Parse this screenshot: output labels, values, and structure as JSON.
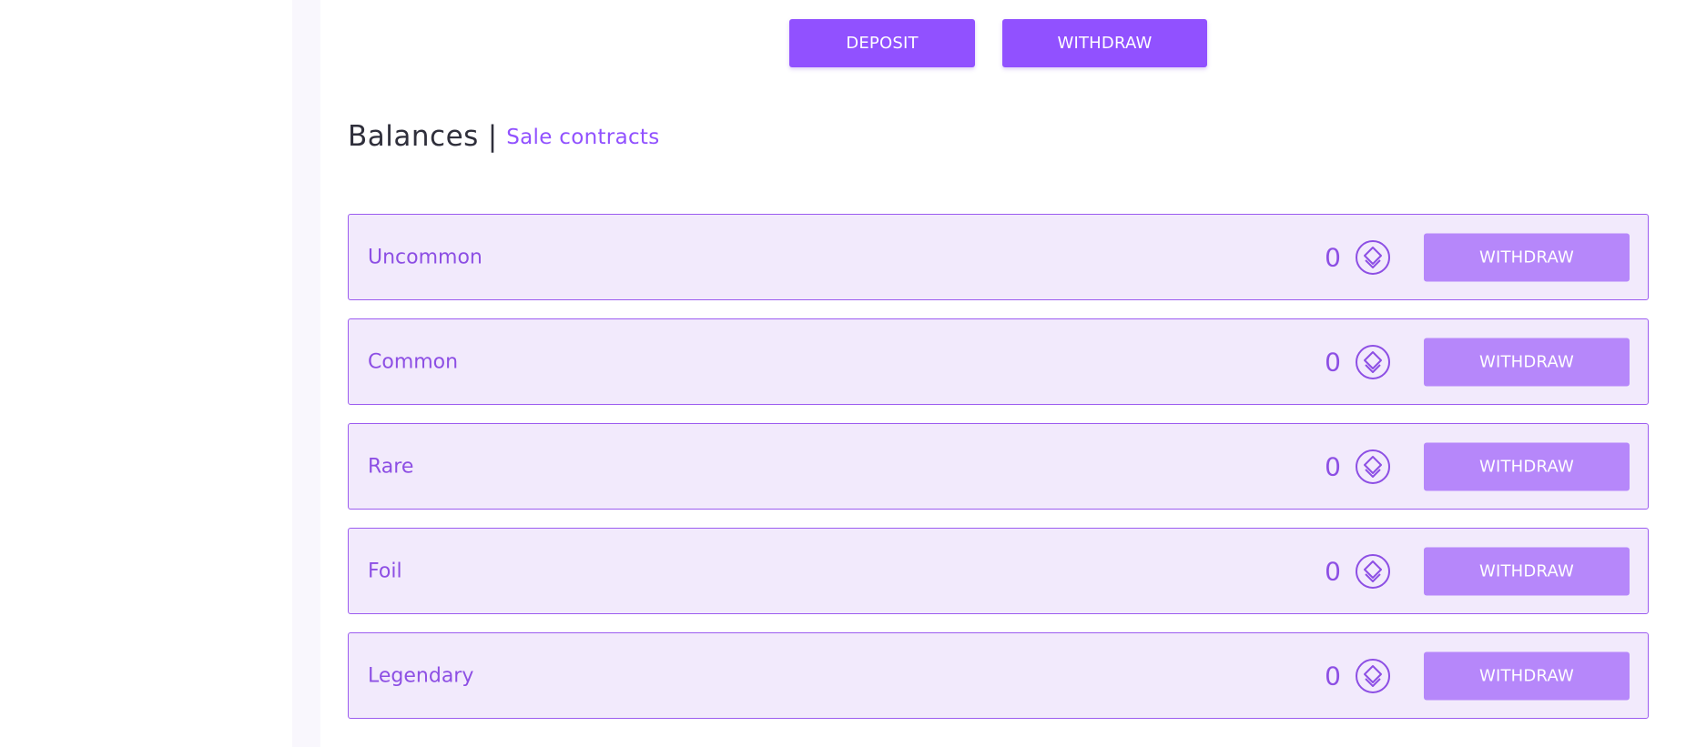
{
  "actions": {
    "deposit_label": "DEPOSIT",
    "withdraw_label": "WITHDRAW"
  },
  "heading": {
    "title": "Balances",
    "separator": "|",
    "link": "Sale contracts"
  },
  "balances": [
    {
      "label": "Uncommon",
      "amount": "0",
      "icon": "token-icon",
      "button": "WITHDRAW"
    },
    {
      "label": "Common",
      "amount": "0",
      "icon": "token-icon",
      "button": "WITHDRAW"
    },
    {
      "label": "Rare",
      "amount": "0",
      "icon": "token-icon",
      "button": "WITHDRAW"
    },
    {
      "label": "Foil",
      "amount": "0",
      "icon": "token-icon",
      "button": "WITHDRAW"
    },
    {
      "label": "Legendary",
      "amount": "0",
      "icon": "token-icon",
      "button": "WITHDRAW"
    }
  ],
  "colors": {
    "accent": "#9151ff",
    "accent_light": "#b687fa",
    "row_bg": "#f2eafc",
    "row_border": "#9c5cf0",
    "text_purple": "#8d4fe4",
    "heading_text": "#2f2f3b"
  }
}
